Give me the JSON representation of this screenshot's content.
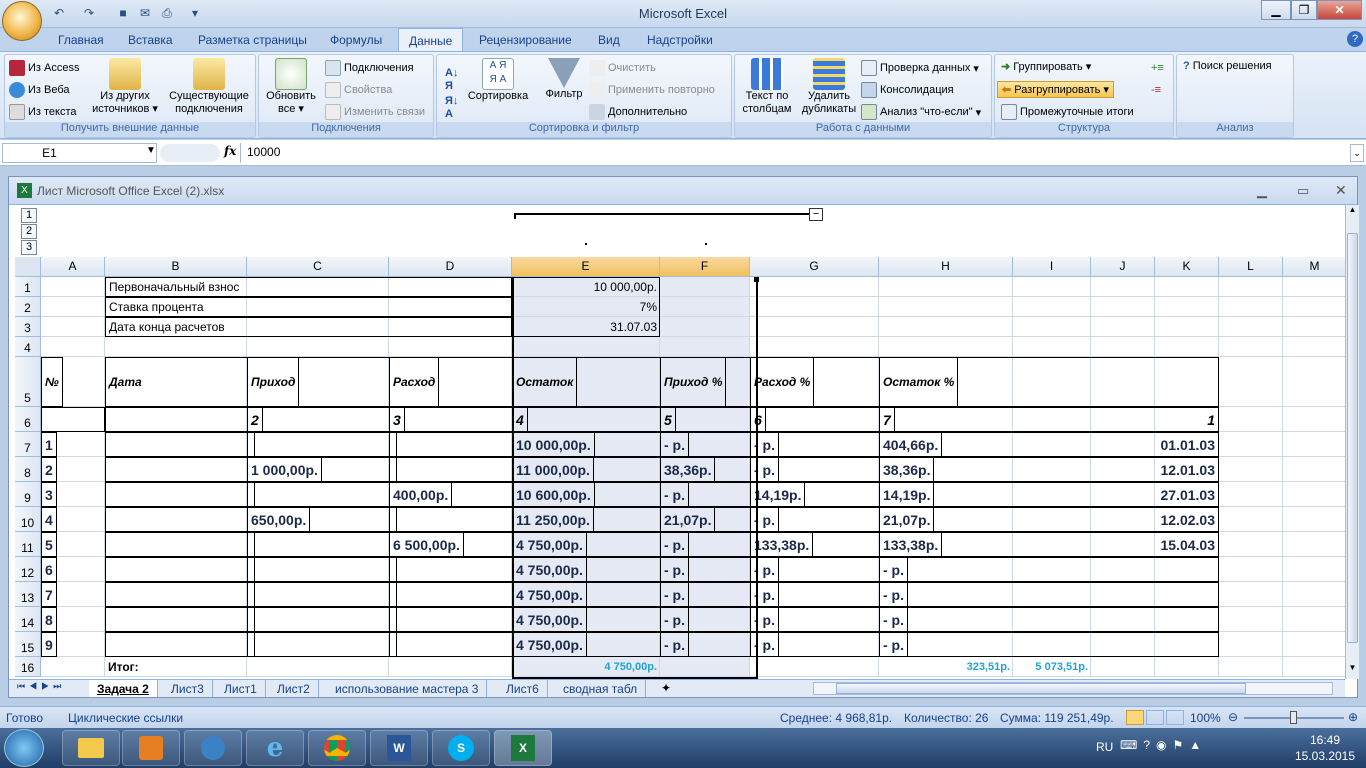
{
  "app_title": "Microsoft Excel",
  "ribbon_tabs": [
    "Главная",
    "Вставка",
    "Разметка страницы",
    "Формулы",
    "Данные",
    "Рецензирование",
    "Вид",
    "Надстройки"
  ],
  "active_tab": "Данные",
  "ribbon": {
    "ext": {
      "access": "Из Access",
      "web": "Из Веба",
      "text": "Из текста",
      "other": "Из других источников",
      "existing": "Существующие подключения",
      "label": "Получить внешние данные"
    },
    "conn": {
      "refresh": "Обновить все",
      "connections": "Подключения",
      "props": "Свойства",
      "edit": "Изменить связи",
      "label": "Подключения"
    },
    "sort": {
      "sort": "Сортировка",
      "filter": "Фильтр",
      "clear": "Очистить",
      "reapply": "Применить повторно",
      "advanced": "Дополнительно",
      "label": "Сортировка и фильтр"
    },
    "tools": {
      "text_to_cols": "Текст по столбцам",
      "remove_dup": "Удалить дубликаты",
      "validation": "Проверка данных",
      "consolidate": "Консолидация",
      "whatif": "Анализ \"что-если\"",
      "label": "Работа с данными"
    },
    "outline": {
      "group": "Группировать",
      "ungroup": "Разгруппировать",
      "subtotal": "Промежуточные итоги",
      "label": "Структура"
    },
    "analysis": {
      "solver": "Поиск решения",
      "label": "Анализ"
    }
  },
  "name_box": "E1",
  "formula": "10000",
  "workbook_title": "Лист Microsoft Office Excel (2).xlsx",
  "outline_levels": [
    "1",
    "2",
    "3"
  ],
  "columns": [
    "A",
    "B",
    "C",
    "D",
    "E",
    "F",
    "G",
    "H",
    "I",
    "J",
    "K",
    "L",
    "M"
  ],
  "rows": [
    "1",
    "2",
    "3",
    "4",
    "5",
    "6",
    "7",
    "8",
    "9",
    "10",
    "11",
    "12",
    "13",
    "14",
    "15",
    "16"
  ],
  "info": {
    "initial_label": "Первоначальный взнос",
    "initial_value": "10 000,00р.",
    "rate_label": "Ставка процента",
    "rate_value": "7%",
    "date_label": "Дата конца расчетов",
    "date_value": "31.07.03"
  },
  "table_headers": [
    "№",
    "Дата",
    "Приход",
    "Расход",
    "Остаток",
    "Приход %",
    "Расход %",
    "Остаток %"
  ],
  "col_numbers": [
    "1",
    "2",
    "3",
    "4",
    "5",
    "6",
    "7"
  ],
  "data_rows": [
    [
      "1",
      "01.01.03",
      "",
      "",
      "10 000,00р.",
      "-    р.",
      "-    р.",
      "404,66р."
    ],
    [
      "2",
      "12.01.03",
      "1 000,00р.",
      "",
      "11 000,00р.",
      "38,36р.",
      "-    р.",
      "38,36р."
    ],
    [
      "3",
      "27.01.03",
      "",
      "400,00р.",
      "10 600,00р.",
      "-    р.",
      "14,19р.",
      "14,19р."
    ],
    [
      "4",
      "12.02.03",
      "650,00р.",
      "",
      "11 250,00р.",
      "21,07р.",
      "-    р.",
      "21,07р."
    ],
    [
      "5",
      "15.04.03",
      "",
      "6 500,00р.",
      "4 750,00р.",
      "-    р.",
      "133,38р.",
      "133,38р."
    ],
    [
      "6",
      "",
      "",
      "",
      "4 750,00р.",
      "-    р.",
      "-    р.",
      "-    р."
    ],
    [
      "7",
      "",
      "",
      "",
      "4 750,00р.",
      "-    р.",
      "-    р.",
      "-    р."
    ],
    [
      "8",
      "",
      "",
      "",
      "4 750,00р.",
      "-    р.",
      "-    р.",
      "-    р."
    ],
    [
      "9",
      "",
      "",
      "",
      "4 750,00р.",
      "-    р.",
      "-    р.",
      "-    р."
    ]
  ],
  "totals": {
    "label": "Итог:",
    "e": "4 750,00р.",
    "h": "323,51р.",
    "i": "5 073,51р."
  },
  "sheet_tabs": [
    "Задача 2",
    "Лист3",
    "Лист1",
    "Лист2",
    "использование мастера 3",
    "Лист6",
    "сводная табл"
  ],
  "active_sheet": "Задача 2",
  "status": {
    "ready": "Готово",
    "circular": "Циклические ссылки",
    "avg": "Среднее:  4 968,81р.",
    "count": "Количество: 26",
    "sum": "Сумма:  119 251,49р.",
    "zoom": "100%"
  },
  "tray": {
    "lang": "RU",
    "time": "16:49",
    "date": "15.03.2015"
  }
}
